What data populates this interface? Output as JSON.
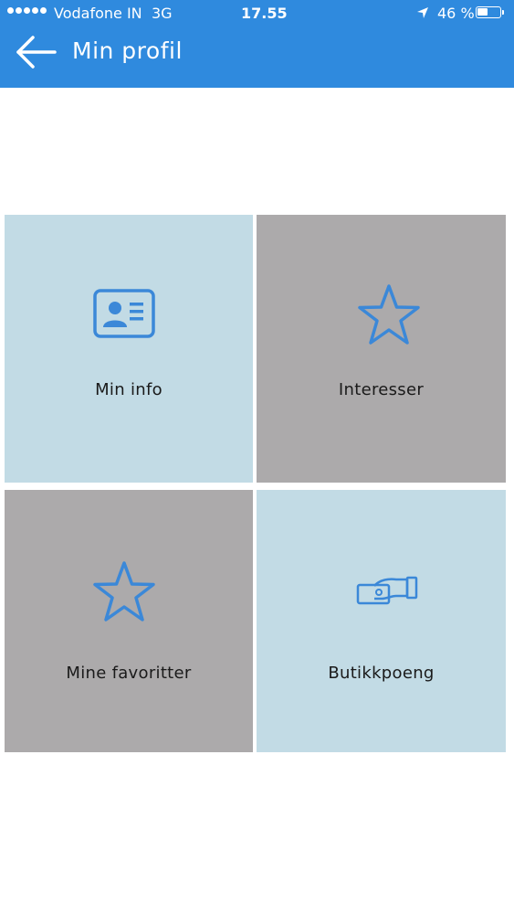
{
  "status_bar": {
    "carrier": "Vodafone IN",
    "network": "3G",
    "time": "17.55",
    "battery_percent": "46 %",
    "battery_level": 0.46
  },
  "header": {
    "title": "Min profil",
    "back_icon": "arrow-left-icon",
    "background_color": "#2f8ade"
  },
  "tiles": [
    {
      "label": "Min info",
      "icon": "id-card-icon",
      "background_color": "#c2dbe5"
    },
    {
      "label": "Interesser",
      "icon": "star-icon",
      "background_color": "#acaaab"
    },
    {
      "label": "Mine favoritter",
      "icon": "star-icon",
      "background_color": "#acaaab"
    },
    {
      "label": "Butikkpoeng",
      "icon": "hand-card-icon",
      "background_color": "#c2dbe5"
    }
  ],
  "colors": {
    "accent": "#2f8ade",
    "icon_color": "#3b88d8"
  }
}
